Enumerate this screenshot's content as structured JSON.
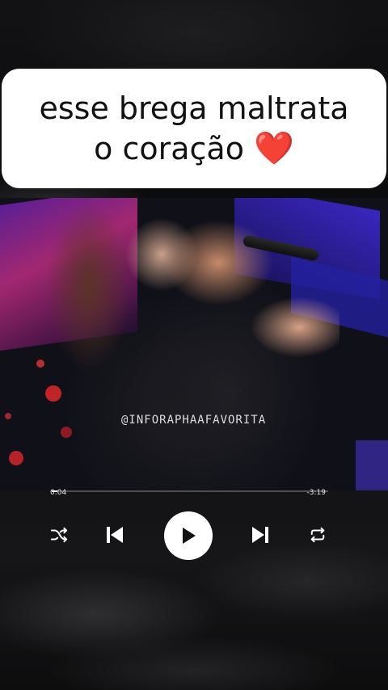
{
  "caption": {
    "line1": "esse brega maltrata",
    "line2": "o coração",
    "emoji": "❤️"
  },
  "video": {
    "watermark": "@INFORAPHAAFAVORITA"
  },
  "player": {
    "elapsed": "0:04",
    "remaining": "-3:19",
    "progress_fraction": 0.02,
    "controls": {
      "shuffle_icon": "shuffle-icon",
      "previous_icon": "skip-previous-icon",
      "play_icon": "play-icon",
      "next_icon": "skip-next-icon",
      "repeat_icon": "repeat-icon"
    }
  },
  "colors": {
    "caption_bg": "#ffffff",
    "caption_text": "#111111",
    "heart": "#e0202c",
    "player_fg": "#ffffff",
    "background": "#0b0b0c"
  }
}
